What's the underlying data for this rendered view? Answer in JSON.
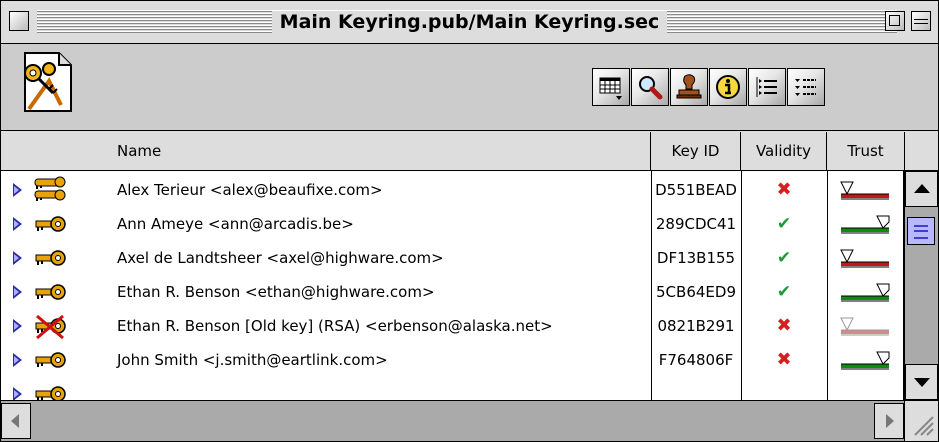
{
  "window": {
    "title": "Main Keyring.pub/Main Keyring.sec"
  },
  "toolbar": {
    "icons": [
      "keyring-document-icon",
      "view-options-icon",
      "search-icon",
      "sign-stamp-icon",
      "info-icon",
      "expand-list-icon",
      "collapse-list-icon"
    ]
  },
  "columns": {
    "name": "Name",
    "key_id": "Key ID",
    "validity": "Validity",
    "trust": "Trust"
  },
  "colors": {
    "invalid": "#d42020",
    "valid": "#1f9a3a",
    "key_gold": "#e8a20a",
    "trust_untrusted": "#c01818",
    "trust_trusted": "#128a12"
  },
  "rows": [
    {
      "name": "Alex Terieur <alex@beaufixe.com>",
      "key_id": "D551BEAD",
      "validity": "invalid",
      "validity_mark": "✖",
      "trust": "untrusted",
      "key_type": "key-pair-icon"
    },
    {
      "name": "Ann Ameye <ann@arcadis.be>",
      "key_id": "289CDC41",
      "validity": "valid",
      "validity_mark": "✔",
      "trust": "trusted",
      "key_type": "public-key-icon"
    },
    {
      "name": "Axel de Landtsheer <axel@highware.com>",
      "key_id": "DF13B155",
      "validity": "valid",
      "validity_mark": "✔",
      "trust": "untrusted",
      "key_type": "public-key-icon"
    },
    {
      "name": "Ethan R. Benson <ethan@highware.com>",
      "key_id": "5CB64ED9",
      "validity": "valid",
      "validity_mark": "✔",
      "trust": "trusted",
      "key_type": "public-key-icon"
    },
    {
      "name": "Ethan R. Benson [Old key] (RSA) <erbenson@alaska.net>",
      "key_id": "0821B291",
      "validity": "invalid",
      "validity_mark": "✖",
      "trust": "untrusted-dim",
      "key_type": "revoked-key-icon"
    },
    {
      "name": "John Smith <j.smith@eartlink.com>",
      "key_id": "F764806F",
      "validity": "invalid",
      "validity_mark": "✖",
      "trust": "trusted",
      "key_type": "public-key-icon"
    }
  ]
}
